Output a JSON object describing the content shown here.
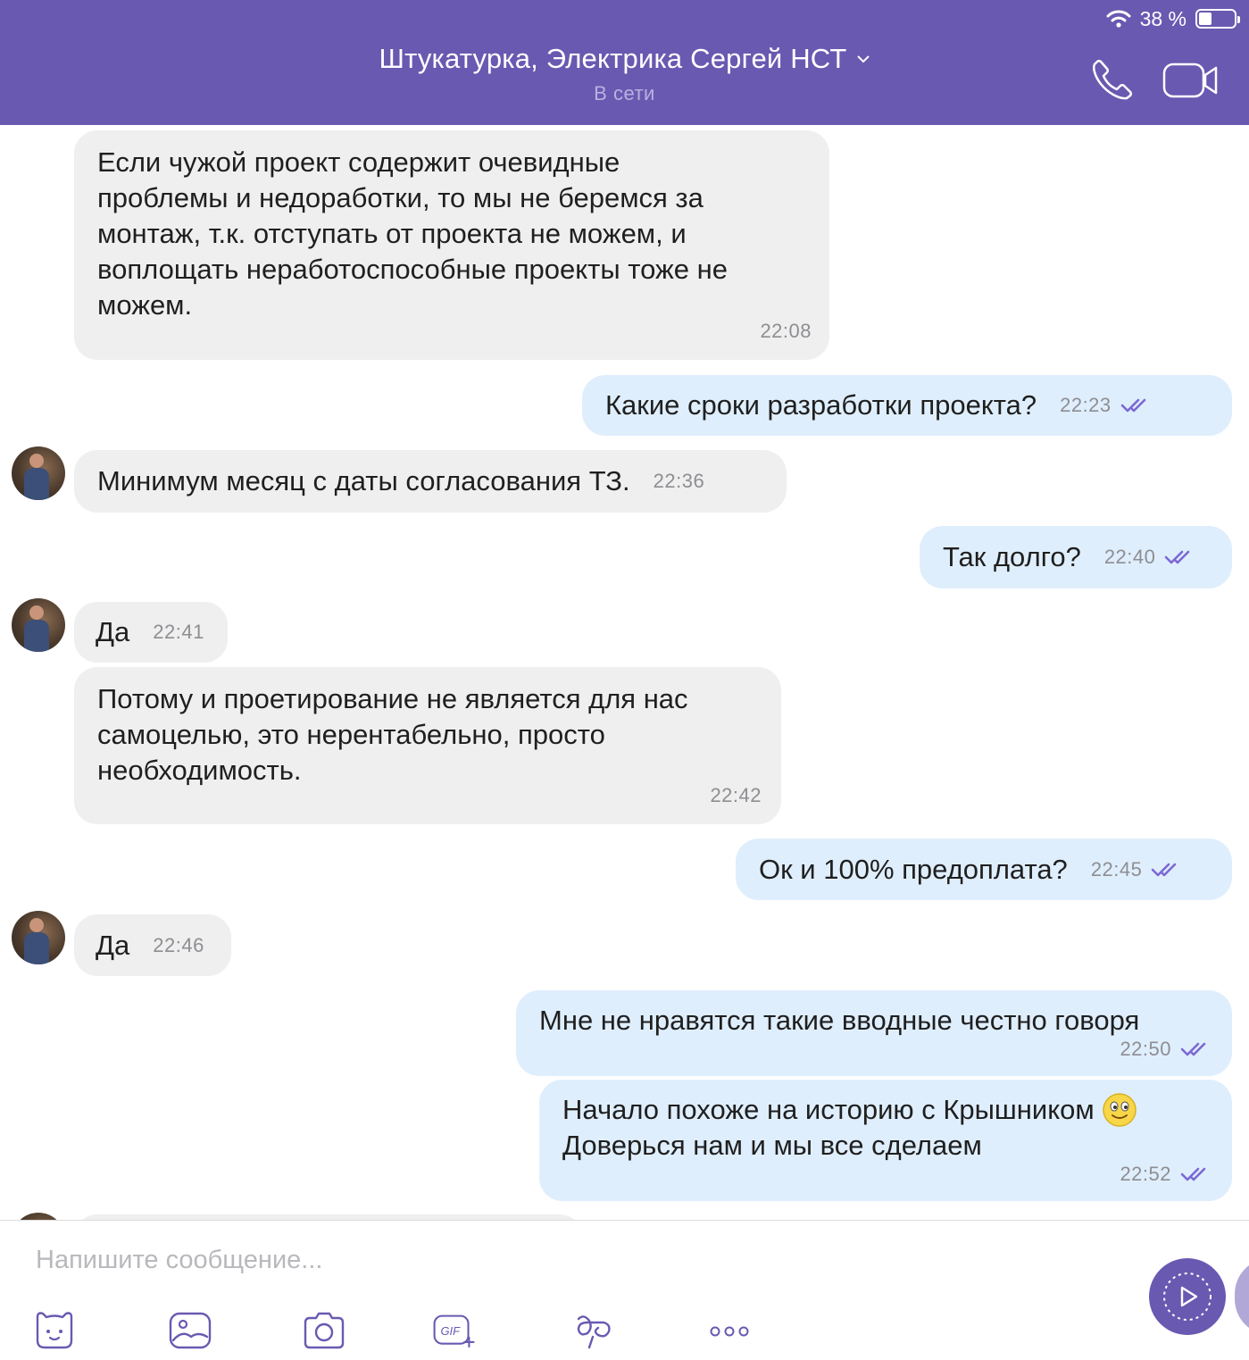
{
  "status_bar": {
    "battery_text": "38 %",
    "battery_level": 0.38
  },
  "header": {
    "title": "Штукатурка, Электрика Сергей НСТ",
    "subtitle": "В сети",
    "colors": {
      "bar": "#6a59b1",
      "subtitle": "#b9b1e0"
    }
  },
  "messages": [
    {
      "dir": "in",
      "lines": [
        "Если чужой проект содержит очевидные",
        "проблемы и недоработки, то мы не беремся за",
        "монтаж, т.к. отступать от проекта не можем, и",
        "воплощать неработоспособные проекты тоже не",
        "можем."
      ],
      "time": "22:08"
    },
    {
      "dir": "out",
      "text": "Какие сроки разработки проекта?",
      "time": "22:23"
    },
    {
      "dir": "in",
      "text": "Минимум месяц с даты согласования ТЗ.",
      "time": "22:36"
    },
    {
      "dir": "out",
      "text": "Так долго?",
      "time": "22:40"
    },
    {
      "dir": "in",
      "text": "Да",
      "time": "22:41"
    },
    {
      "dir": "in",
      "lines": [
        "Потому и проетирование не является для нас",
        "самоцелью, это нерентабельно, просто",
        "необходимость."
      ],
      "time": "22:42"
    },
    {
      "dir": "out",
      "text": "Ок и 100% предоплата?",
      "time": "22:45"
    },
    {
      "dir": "in",
      "text": "Да",
      "time": "22:46"
    },
    {
      "dir": "out",
      "text": "Мне не нравятся такие вводные честно говоря",
      "time": "22:50"
    },
    {
      "dir": "out",
      "lines": [
        "Начало похоже на историю с Крышником",
        "Доверься нам и мы все сделаем"
      ],
      "emoji": "smiley",
      "time": "22:52"
    }
  ],
  "composer": {
    "placeholder": "Напишите сообщение...",
    "tools": [
      "sticker-icon",
      "gallery-icon",
      "camera-icon",
      "gif-icon",
      "doodle-icon",
      "more-icon"
    ],
    "gif_label": "GIF"
  },
  "colors": {
    "incoming": "#efefef",
    "outgoing": "#dfeefc",
    "accent": "#6a59b1",
    "check": "#7b68d4"
  }
}
